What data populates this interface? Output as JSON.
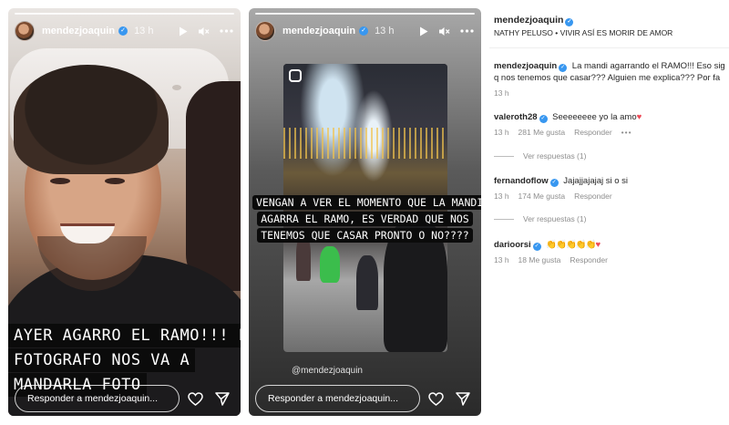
{
  "story1": {
    "username": "mendezjoaquin",
    "time": "13 h",
    "caption_lines": [
      "AYER AGARRO EL RAMO!!! EL",
      "FOTOGRAFO NOS VA A",
      "MANDARLA FOTO"
    ],
    "reply_placeholder": "Responder a mendezjoaquin..."
  },
  "story2": {
    "username": "mendezjoaquin",
    "time": "13 h",
    "caption_lines": [
      "VENGAN A  VER EL MOMENTO QUE LA MANDI",
      "AGARRA EL RAMO, ES VERDAD QUE NOS",
      "TENEMOS QUE CASAR PRONTO O NO????"
    ],
    "mention": "@mendezjoaquin",
    "reply_placeholder": "Responder a mendezjoaquin..."
  },
  "panel": {
    "author": "mendezjoaquin",
    "audio": "NATHY PELUSO • VIVIR ASÍ ES MORIR DE AMOR",
    "caption": {
      "user": "mendezjoaquin",
      "line1": "La mandi agarrando el RAMO!!! Eso sig",
      "line2": "q nos tenemos que casar??? Alguien me explica??? Por fa",
      "time": "13 h"
    },
    "comments": [
      {
        "user": "valeroth28",
        "text": "Seeeeeeee yo la amo",
        "emoji": "♥",
        "time": "13 h",
        "likes": "281 Me gusta",
        "reply": "Responder",
        "more": "•••",
        "view_replies": "Ver respuestas (1)"
      },
      {
        "user": "fernandoflow",
        "text": "Jajajjajajaj si o si",
        "emoji": "",
        "time": "13 h",
        "likes": "174 Me gusta",
        "reply": "Responder",
        "more": "",
        "view_replies": "Ver respuestas (1)"
      },
      {
        "user": "darioorsi",
        "text": "",
        "emoji_claps": "👏👏👏👏👏",
        "emoji": "♥",
        "time": "13 h",
        "likes": "18 Me gusta",
        "reply": "Responder"
      }
    ]
  },
  "colors": {
    "verified": "#3897f0",
    "heart": "#ed4956",
    "meta": "#8e8e8e"
  },
  "icons": [
    "play-icon",
    "mute-icon",
    "more-icon",
    "heart-icon",
    "send-icon",
    "verified-badge-icon",
    "reel-icon"
  ]
}
